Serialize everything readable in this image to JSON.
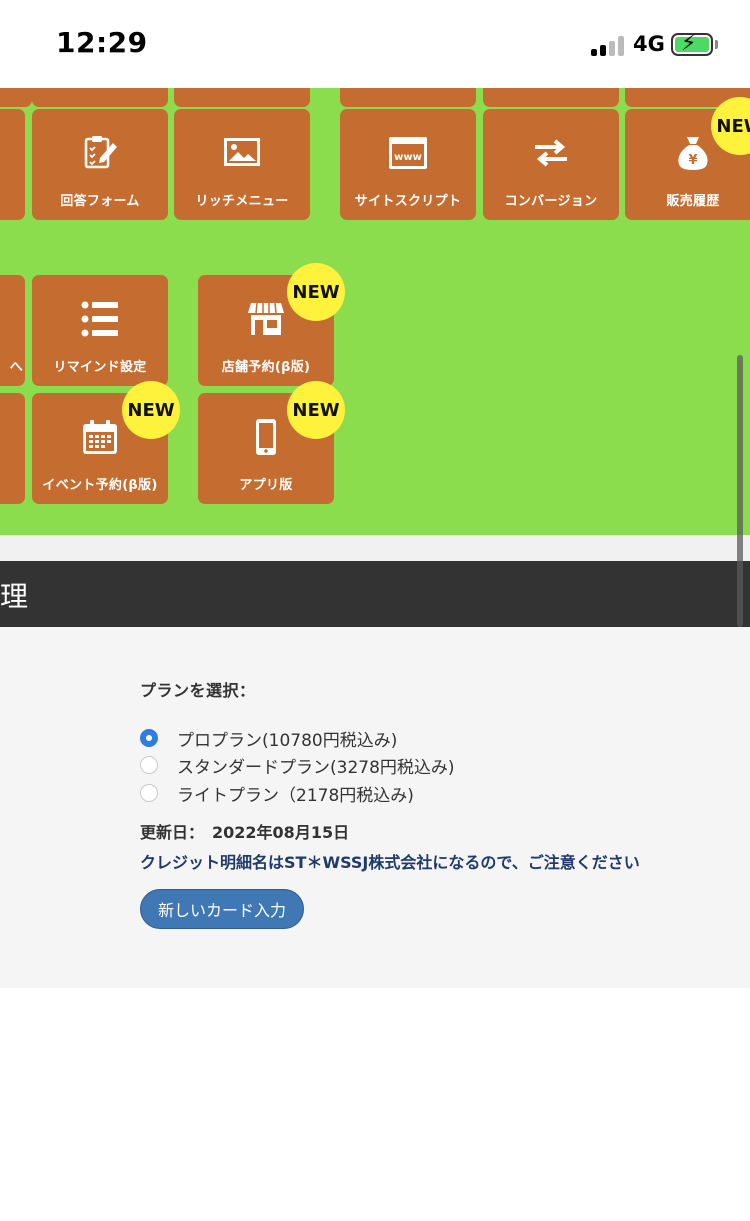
{
  "status_bar": {
    "time": "12:29",
    "network": "4G"
  },
  "menu": {
    "row0_partial": [
      "",
      "",
      "",
      "",
      ""
    ],
    "row1": [
      {
        "label": "回答フォーム",
        "icon": "clipboard-icon"
      },
      {
        "label": "リッチメニュー",
        "icon": "image-icon"
      },
      {
        "label": "サイトスクリプト",
        "icon": "browser-www-icon"
      },
      {
        "label": "コンバージョン",
        "icon": "exchange-arrows-icon"
      },
      {
        "label": "販売履歴",
        "icon": "money-bag-yen-icon",
        "badge": "NEW"
      }
    ],
    "row2": [
      {
        "label": "へ",
        "icon": ""
      },
      {
        "label": "リマインド設定",
        "icon": "list-icon"
      },
      {
        "label": "店舗予約(β版)",
        "icon": "store-icon",
        "badge": "NEW"
      }
    ],
    "row3": [
      {
        "label": "イベント予約(β版)",
        "icon": "calendar-icon",
        "badge": "NEW"
      },
      {
        "label": "アプリ版",
        "icon": "smartphone-icon",
        "badge": "NEW"
      }
    ]
  },
  "section": {
    "title": "理"
  },
  "plan": {
    "label": "プランを選択：",
    "options": [
      {
        "text": "プロプラン(10780円税込み)",
        "checked": true
      },
      {
        "text": "スタンダードプラン(3278円税込み)",
        "checked": false
      },
      {
        "text": "ライトプラン（2178円税込み)",
        "checked": false
      }
    ],
    "update_label": "更新日：",
    "update_date": "2022年08月15日",
    "notice": "クレジット明細名はST＊WSSJ株式会社になるので、ご注意ください",
    "button_label": "新しいカード入力"
  },
  "colors": {
    "green": "#8cdd4d",
    "tile": "#c56d30",
    "badge": "#fff23c",
    "header": "#333333",
    "radio": "#2f7de1",
    "button": "#3f78b5",
    "notice": "#203b6b"
  }
}
